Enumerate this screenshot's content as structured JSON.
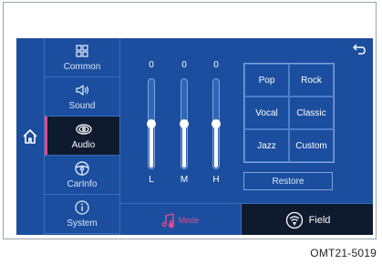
{
  "nav": {
    "home_icon": "home-icon",
    "items": [
      {
        "label": "Common",
        "icon": "grid-icon",
        "active": false
      },
      {
        "label": "Sound",
        "icon": "speaker-icon",
        "active": false
      },
      {
        "label": "Audio",
        "icon": "audio-rings-icon",
        "active": true
      },
      {
        "label": "CarInfo",
        "icon": "steering-wheel-icon",
        "active": false
      },
      {
        "label": "System",
        "icon": "info-icon",
        "active": false
      }
    ]
  },
  "equalizer": {
    "back_icon": "back-arrow-icon",
    "sliders": [
      {
        "label": "L",
        "value": "0",
        "level": 0.5
      },
      {
        "label": "M",
        "value": "0",
        "level": 0.5
      },
      {
        "label": "H",
        "value": "0",
        "level": 0.5
      }
    ],
    "presets": [
      "Pop",
      "Rock",
      "Vocal",
      "Classic",
      "Jazz",
      "Custom"
    ],
    "restore_label": "Restore"
  },
  "bottom": {
    "mode_label": "Mode",
    "field_label": "Field"
  },
  "figure_code": "OMT21-5019",
  "colors": {
    "screen_bg": "#1b4e9e",
    "active_bg": "#0e1a2e",
    "accent": "#e24a8c"
  }
}
